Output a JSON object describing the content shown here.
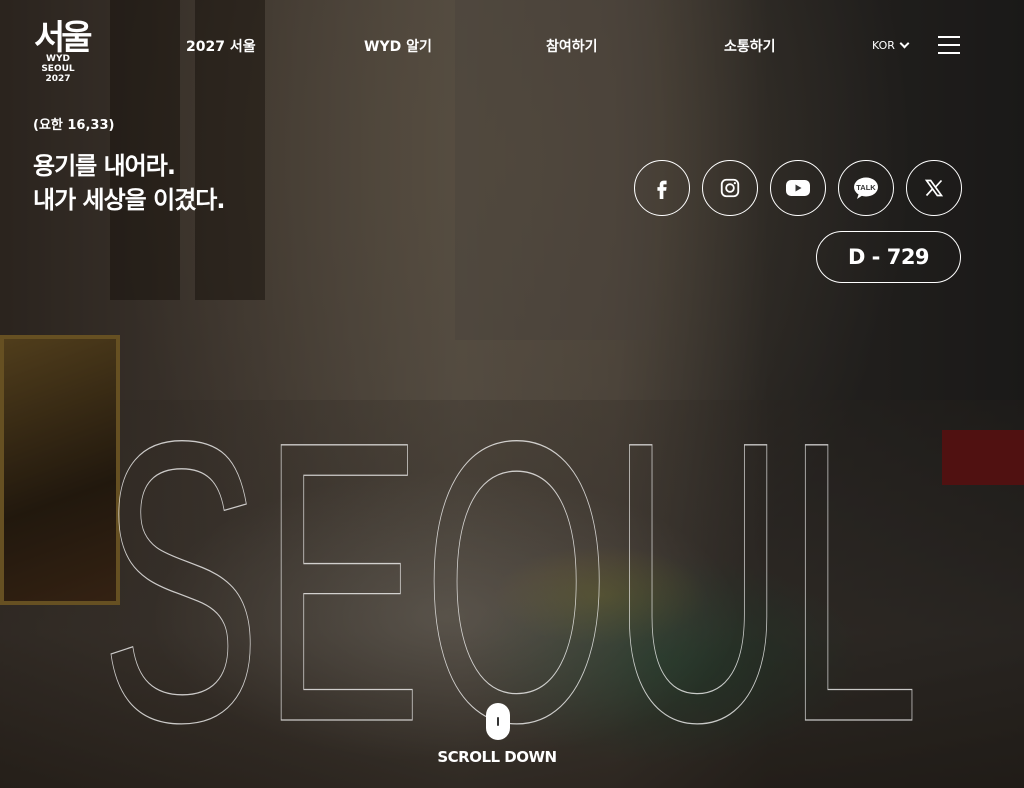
{
  "header": {
    "logo_alt": "WYD SEOUL 2027",
    "logo_script": "서울",
    "logo_line1": "WYD",
    "logo_line2": "SEOUL",
    "logo_line3": "2027",
    "nav": [
      {
        "label": "2027 서울"
      },
      {
        "label": "WYD 알기"
      },
      {
        "label": "참여하기"
      },
      {
        "label": "소통하기"
      }
    ],
    "language": "KOR"
  },
  "hero": {
    "verse_ref": "(요한 16,33)",
    "verse_line1": "용기를 내어라.",
    "verse_line2": "내가 세상을 이겼다.",
    "watermark_text": "SEOUL"
  },
  "social": [
    {
      "name": "facebook",
      "icon": "facebook-icon"
    },
    {
      "name": "instagram",
      "icon": "instagram-icon"
    },
    {
      "name": "youtube",
      "icon": "youtube-icon"
    },
    {
      "name": "kakaotalk",
      "icon": "talk-icon",
      "label": "TALK"
    },
    {
      "name": "x",
      "icon": "x-icon"
    }
  ],
  "dday": "D - 729",
  "scroll": {
    "label": "SCROLL DOWN"
  }
}
